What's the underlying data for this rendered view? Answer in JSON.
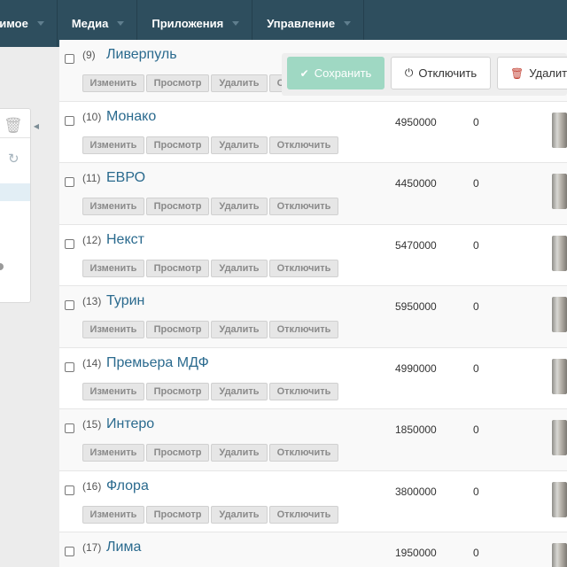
{
  "nav": {
    "items": [
      {
        "label": "жимое"
      },
      {
        "label": "Медиа"
      },
      {
        "label": "Приложения"
      },
      {
        "label": "Управление"
      }
    ]
  },
  "sidebar": {
    "icons": [
      "trash-icon",
      "refresh-icon"
    ]
  },
  "toolbar": {
    "save_label": "Сохранить",
    "save_icon": "check-icon",
    "disable_label": "Отключить",
    "disable_icon": "power-icon",
    "delete_label": "Удалить",
    "delete_icon": "trash-icon",
    "accent_color": "#9fd8c3"
  },
  "actions": {
    "edit": "Изменить",
    "view": "Просмотр",
    "delete": "Удалить",
    "disable": "Отключить"
  },
  "rows": [
    {
      "num": "(9)",
      "name": "Ливерпуль",
      "price": "",
      "qty": ""
    },
    {
      "num": "(10)",
      "name": "Монако",
      "price": "4950000",
      "qty": "0"
    },
    {
      "num": "(11)",
      "name": "ЕВРО",
      "price": "4450000",
      "qty": "0"
    },
    {
      "num": "(12)",
      "name": "Некст",
      "price": "5470000",
      "qty": "0"
    },
    {
      "num": "(13)",
      "name": "Турин",
      "price": "5950000",
      "qty": "0"
    },
    {
      "num": "(14)",
      "name": "Премьера МДФ",
      "price": "4990000",
      "qty": "0"
    },
    {
      "num": "(15)",
      "name": "Интеро",
      "price": "1850000",
      "qty": "0"
    },
    {
      "num": "(16)",
      "name": "Флора",
      "price": "3800000",
      "qty": "0"
    },
    {
      "num": "(17)",
      "name": "Лима",
      "price": "1950000",
      "qty": "0"
    }
  ]
}
